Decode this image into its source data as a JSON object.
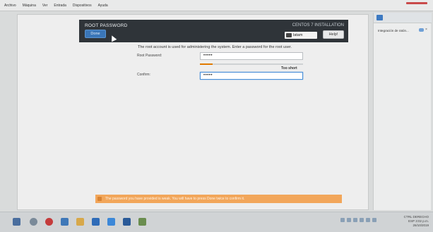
{
  "menubar": {
    "items": [
      "Archivo",
      "Máquina",
      "Ver",
      "Entrada",
      "Dispositivos",
      "Ayuda"
    ]
  },
  "installer": {
    "title": "ROOT PASSWORD",
    "subtitle": "CENTOS 7 INSTALLATION",
    "done_label": "Done",
    "keyboard_layout": "latam",
    "help_label": "Help!",
    "description": "The root account is used for administering the system.  Enter a password for the root user.",
    "root_password_label": "Root Password:",
    "root_password_value": "•••••",
    "confirm_label": "Confirm:",
    "confirm_value": "•••••",
    "strength_text": "Too short",
    "strength_fraction": 0.12,
    "warning_text": "The password you have provided is weak. You will have to press Done twice to confirm it."
  },
  "side_panel": {
    "item_label": "Integración de ratón..."
  },
  "colors": {
    "header_bg": "#2f3439",
    "done_blue": "#3a76b8",
    "warning_orange": "#f2a65a",
    "strength_orange": "#e07a00"
  },
  "taskbar": {
    "icons": [
      "windows-start-icon",
      "search-icon",
      "opera-icon",
      "save-icon",
      "file-explorer-icon",
      "outlook-icon",
      "vscode-icon",
      "virtualbox-icon",
      "image-viewer-icon"
    ],
    "tray_lang": "ESP",
    "tray_line1": "CTRL DERECHO",
    "tray_time": "3:02 p.m.",
    "tray_date": "26/10/2019"
  }
}
